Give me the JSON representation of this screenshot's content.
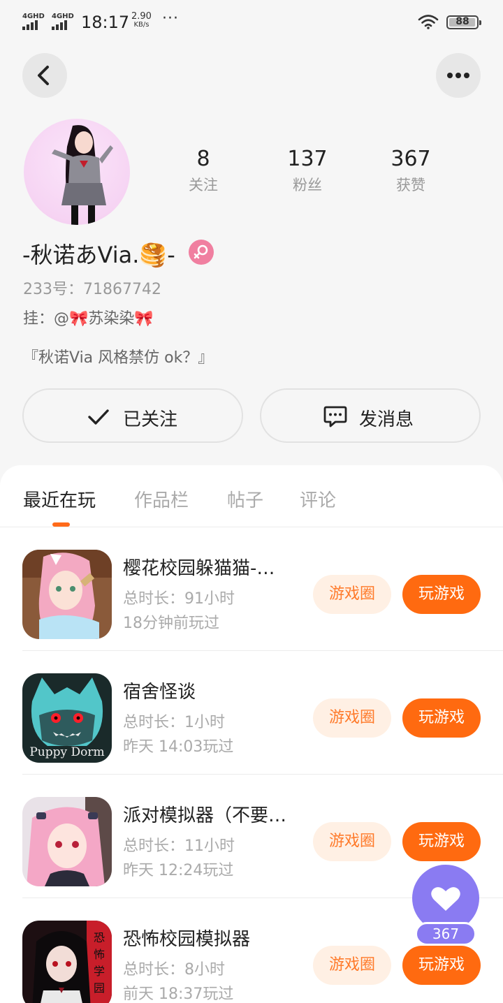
{
  "status_bar": {
    "signal1": "4GHD",
    "signal2": "4GHD",
    "time": "18:17",
    "speed_value": "2.90",
    "speed_unit": "KB/s",
    "more": "···",
    "battery": "88"
  },
  "profile": {
    "stats": [
      {
        "value": "8",
        "label": "关注"
      },
      {
        "value": "137",
        "label": "粉丝"
      },
      {
        "value": "367",
        "label": "获赞"
      }
    ],
    "nickname": "-秋诺あVia.🥞-",
    "uid": "233号：71867742",
    "hang": "挂：@🎀苏染染🎀",
    "bio": "『秋诺Via  风格禁仿  ok？』",
    "follow_label": "已关注",
    "message_label": "发消息"
  },
  "tabs": [
    "最近在玩",
    "作品栏",
    "帖子",
    "评论"
  ],
  "games": [
    {
      "name": "樱花校园躲猫猫-…",
      "duration": "总时长：91小时",
      "last_played": "18分钟前玩过",
      "circle_label": "游戏圈",
      "play_label": "玩游戏",
      "icon_colors": [
        "#8a5a3a",
        "#f3a9c2"
      ]
    },
    {
      "name": "宿舍怪谈",
      "duration": "总时长：1小时",
      "last_played": "昨天 14:03玩过",
      "circle_label": "游戏圈",
      "play_label": "玩游戏",
      "icon_text": "Puppy Dorm",
      "icon_colors": [
        "#1a2a2a",
        "#52c6c9"
      ]
    },
    {
      "name": "派对模拟器（不要…",
      "duration": "总时长：11小时",
      "last_played": "昨天 12:24玩过",
      "circle_label": "游戏圈",
      "play_label": "玩游戏",
      "icon_colors": [
        "#e9e2e8",
        "#f4a7c6"
      ]
    },
    {
      "name": "恐怖校园模拟器",
      "duration": "总时长：8小时",
      "last_played": "前天 18:37玩过",
      "circle_label": "游戏圈",
      "play_label": "玩游戏",
      "icon_text": "恐怖学园",
      "icon_colors": [
        "#1d0f12",
        "#c81e2a"
      ]
    }
  ],
  "like_fab": {
    "count": "367",
    "icon": "heart-icon"
  },
  "colors": {
    "accent": "#ff6a10",
    "accent_light": "#fff0e4",
    "fab": "#8a7bf2",
    "gender": "#f07fa0"
  }
}
